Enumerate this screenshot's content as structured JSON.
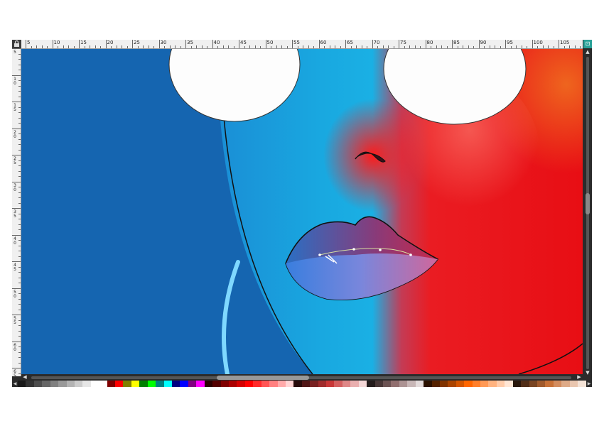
{
  "rulers": {
    "horizontal_labels": [
      "5",
      "10",
      "15",
      "20",
      "25",
      "30",
      "35",
      "40",
      "45",
      "50",
      "55",
      "60",
      "65",
      "70",
      "75",
      "80",
      "85",
      "90",
      "95",
      "100",
      "105"
    ],
    "vertical_labels": [
      "5",
      "10",
      "15",
      "20",
      "25",
      "30",
      "35",
      "40",
      "45",
      "50",
      "55",
      "60",
      "65"
    ]
  },
  "scrollbars": {
    "up_arrow": "▲",
    "down_arrow": "▼",
    "left_arrow": "◀",
    "right_arrow": "▶"
  },
  "corner_button_label": "⊡",
  "palette": {
    "left_arrow": "◀",
    "right_arrow": "▶",
    "swatches": [
      "#1a1a1a",
      "#333333",
      "#4d4d4d",
      "#666666",
      "#808080",
      "#999999",
      "#b3b3b3",
      "#cccccc",
      "#e6e6e6",
      "#ffffff",
      "#ffffff",
      "#800000",
      "#ff0000",
      "#808000",
      "#ffff00",
      "#008000",
      "#00ff00",
      "#008080",
      "#00ffff",
      "#000080",
      "#0000ff",
      "#800080",
      "#ff00ff",
      "#2b0000",
      "#550000",
      "#800000",
      "#aa0000",
      "#d40000",
      "#ff0000",
      "#ff2a2a",
      "#ff5555",
      "#ff8080",
      "#ffaaaa",
      "#ffd5d5",
      "#280b0b",
      "#501616",
      "#782121",
      "#a02c2c",
      "#c83737",
      "#d35f5f",
      "#de8787",
      "#e9afaf",
      "#f4d7d7",
      "#241c1c",
      "#483737",
      "#6c5353",
      "#916f6f",
      "#ac9393",
      "#c8b7b7",
      "#e3dbdb",
      "#2b1100",
      "#552200",
      "#803300",
      "#aa4400",
      "#d45500",
      "#ff6600",
      "#ff7f2a",
      "#ff9955",
      "#ffb380",
      "#ffccaa",
      "#ffe6d5",
      "#28170b",
      "#502d16",
      "#784421",
      "#a05a2c",
      "#c87137",
      "#d38d5f",
      "#deaa87",
      "#e9c6af",
      "#f4e3d7"
    ]
  },
  "colors": {
    "app_bg": "#2b2b2b",
    "background_blue": "#1565b0",
    "accent_teal": "#2aa198"
  }
}
